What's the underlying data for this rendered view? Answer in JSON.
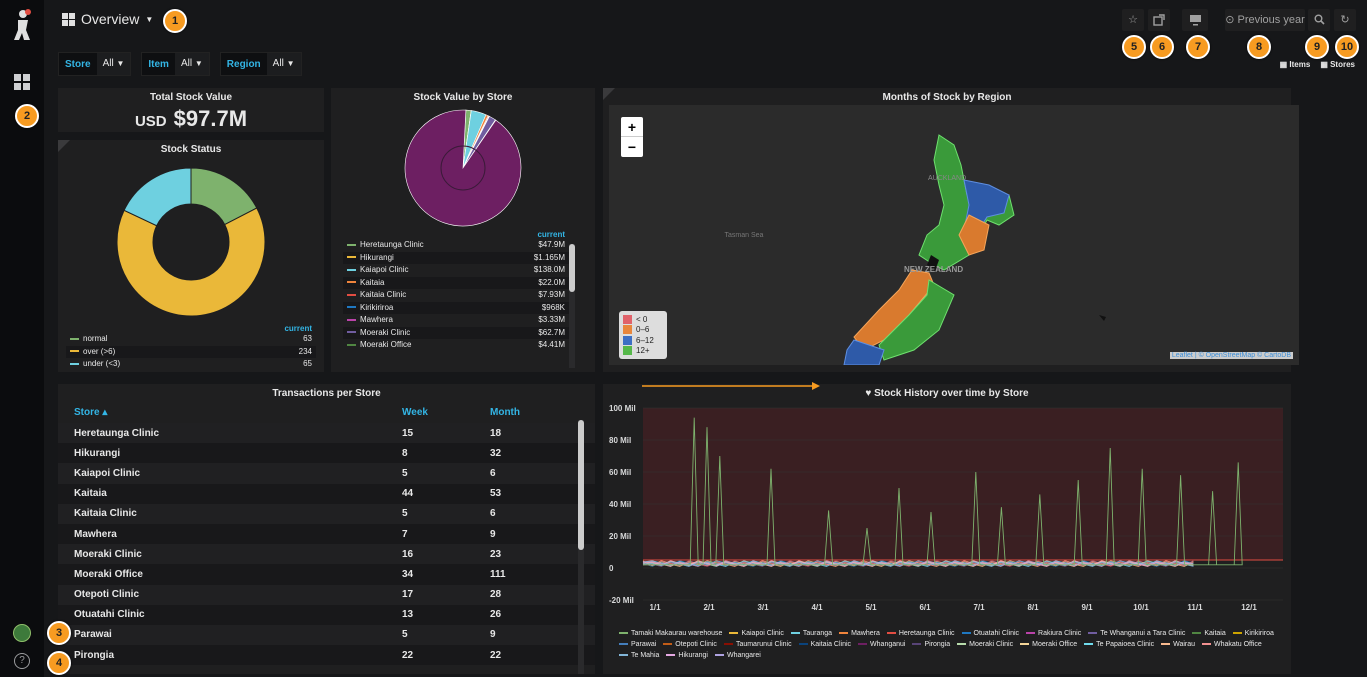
{
  "header": {
    "title": "Overview",
    "time_range": "Previous year",
    "time_icon": "clock-icon",
    "star_icon": "star-icon",
    "share_icon": "share-icon",
    "tv_icon": "tv-icon",
    "zoom_icon": "zoom-icon",
    "refresh_icon": "refresh-icon"
  },
  "badges": [
    "1",
    "2",
    "3",
    "4",
    "5",
    "6",
    "7",
    "8",
    "9",
    "10"
  ],
  "filters": [
    {
      "label": "Store",
      "value": "All"
    },
    {
      "label": "Item",
      "value": "All"
    },
    {
      "label": "Region",
      "value": "All"
    }
  ],
  "links": {
    "items": "Items",
    "stores": "Stores"
  },
  "total_stock": {
    "title": "Total Stock Value",
    "prefix": "USD",
    "value": "$97.7M"
  },
  "stock_status": {
    "title": "Stock Status",
    "legend_header": "current",
    "colors": [
      "#7eb26d",
      "#eab839",
      "#6ed0e0"
    ],
    "items": [
      {
        "label": "normal",
        "value": "63"
      },
      {
        "label": "over (>6)",
        "value": "234"
      },
      {
        "label": "under (<3)",
        "value": "65"
      }
    ]
  },
  "stock_by_store": {
    "title": "Stock Value by Store",
    "legend_header": "current",
    "items": [
      {
        "label": "Heretaunga Clinic",
        "value": "$47.9M",
        "color": "#7eb26d"
      },
      {
        "label": "Hikurangi",
        "value": "$1.165M",
        "color": "#eab839"
      },
      {
        "label": "Kaiapoi Clinic",
        "value": "$138.0M",
        "color": "#6ed0e0"
      },
      {
        "label": "Kaitaia",
        "value": "$22.0M",
        "color": "#ef843c"
      },
      {
        "label": "Kaitaia Clinic",
        "value": "$7.93M",
        "color": "#e24d42"
      },
      {
        "label": "Kirikiriroa",
        "value": "$968K",
        "color": "#1f78c1"
      },
      {
        "label": "Mawhera",
        "value": "$3.33M",
        "color": "#ba43a9"
      },
      {
        "label": "Moeraki Clinic",
        "value": "$62.7M",
        "color": "#705da0"
      },
      {
        "label": "Moeraki Office",
        "value": "$4.41M",
        "color": "#508642"
      }
    ]
  },
  "map": {
    "title": "Months of Stock by Region",
    "zoom_in": "+",
    "zoom_out": "−",
    "labels": {
      "auckland": "AUCKLAND",
      "tasman": "Tasman Sea",
      "nz": "NEW ZEALAND"
    },
    "legend": [
      {
        "label": "< 0",
        "color": "#e0626a"
      },
      {
        "label": "0–6",
        "color": "#e8863c"
      },
      {
        "label": "6–12",
        "color": "#3d6fc4"
      },
      {
        "label": "12+",
        "color": "#56b84a"
      }
    ],
    "attribution": "Leaflet | © OpenStreetMap © CartoDB"
  },
  "transactions": {
    "title": "Transactions per Store",
    "columns": [
      "Store ▴",
      "Week",
      "Month"
    ],
    "rows": [
      [
        "Heretaunga Clinic",
        "15",
        "18"
      ],
      [
        "Hikurangi",
        "8",
        "32"
      ],
      [
        "Kaiapoi Clinic",
        "5",
        "6"
      ],
      [
        "Kaitaia",
        "44",
        "53"
      ],
      [
        "Kaitaia Clinic",
        "5",
        "6"
      ],
      [
        "Mawhera",
        "7",
        "9"
      ],
      [
        "Moeraki Clinic",
        "16",
        "23"
      ],
      [
        "Moeraki Office",
        "34",
        "111"
      ],
      [
        "Otepoti Clinic",
        "17",
        "28"
      ],
      [
        "Otuatahi Clinic",
        "13",
        "26"
      ],
      [
        "Parawai",
        "5",
        "9"
      ],
      [
        "Pirongia",
        "22",
        "22"
      ]
    ]
  },
  "history": {
    "title": "Stock History over time by Store",
    "heart_icon": "heart-icon"
  },
  "chart_data": {
    "type": "line",
    "title": "Stock History over time by Store",
    "x": [
      "1/1",
      "2/1",
      "3/1",
      "4/1",
      "5/1",
      "6/1",
      "7/1",
      "8/1",
      "9/1",
      "10/1",
      "11/1",
      "12/1"
    ],
    "y_ticks": [
      "100 Mil",
      "80 Mil",
      "60 Mil",
      "40 Mil",
      "20 Mil",
      "0",
      "-20 Mil"
    ],
    "ylim": [
      -20,
      100
    ],
    "threshold": 5,
    "legend": [
      {
        "name": "Tamaki Makaurau warehouse",
        "color": "#7eb26d"
      },
      {
        "name": "Kaiapoi Clinic",
        "color": "#eab839"
      },
      {
        "name": "Tauranga",
        "color": "#6ed0e0"
      },
      {
        "name": "Mawhera",
        "color": "#ef843c"
      },
      {
        "name": "Heretaunga Clinic",
        "color": "#e24d42"
      },
      {
        "name": "Otuatahi Clinic",
        "color": "#1f78c1"
      },
      {
        "name": "Rakiura Clinic",
        "color": "#ba43a9"
      },
      {
        "name": "Te Whanganui a Tara Clinic",
        "color": "#705da0"
      },
      {
        "name": "Kaitaia",
        "color": "#508642"
      },
      {
        "name": "Kirikiriroa",
        "color": "#cca300"
      },
      {
        "name": "Parawai",
        "color": "#447ebc"
      },
      {
        "name": "Otepoti Clinic",
        "color": "#c15c17"
      },
      {
        "name": "Taumarunui Clinic",
        "color": "#890f02"
      },
      {
        "name": "Kaitaia Clinic",
        "color": "#0a437c"
      },
      {
        "name": "Whanganui",
        "color": "#6d1f62"
      },
      {
        "name": "Pirongia",
        "color": "#584477"
      },
      {
        "name": "Moeraki Clinic",
        "color": "#b7dbab"
      },
      {
        "name": "Moeraki Office",
        "color": "#f4d598"
      },
      {
        "name": "Te Papaioea Clinic",
        "color": "#70dbed"
      },
      {
        "name": "Wairau",
        "color": "#f9ba8f"
      },
      {
        "name": "Whakatu Office",
        "color": "#f29191"
      },
      {
        "name": "Te Mahia",
        "color": "#82b5d8"
      },
      {
        "name": "Hikurangi",
        "color": "#e5a8e2"
      },
      {
        "name": "Whangarei",
        "color": "#aea2e0"
      }
    ],
    "spikes": [
      {
        "x": 0.08,
        "y": 94
      },
      {
        "x": 0.1,
        "y": 88
      },
      {
        "x": 0.12,
        "y": 70
      },
      {
        "x": 0.2,
        "y": 62
      },
      {
        "x": 0.29,
        "y": 36
      },
      {
        "x": 0.35,
        "y": 25
      },
      {
        "x": 0.4,
        "y": 50
      },
      {
        "x": 0.45,
        "y": 35
      },
      {
        "x": 0.52,
        "y": 60
      },
      {
        "x": 0.56,
        "y": 38
      },
      {
        "x": 0.62,
        "y": 46
      },
      {
        "x": 0.68,
        "y": 55
      },
      {
        "x": 0.73,
        "y": 75
      },
      {
        "x": 0.78,
        "y": 62
      },
      {
        "x": 0.84,
        "y": 58
      },
      {
        "x": 0.89,
        "y": 48
      },
      {
        "x": 0.93,
        "y": 66
      }
    ]
  }
}
